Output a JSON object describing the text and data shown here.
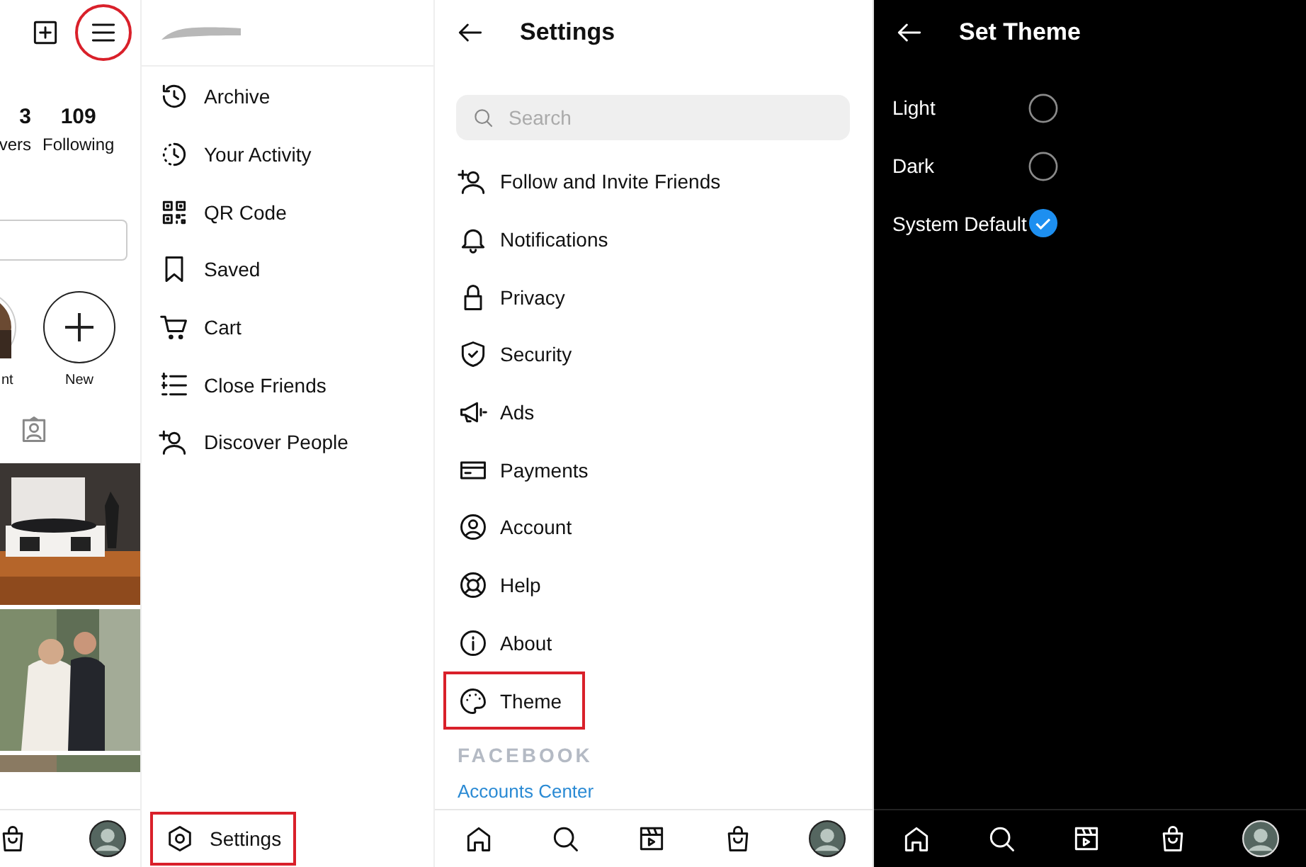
{
  "profile_panel": {
    "menu_highlighted": true,
    "stats": [
      {
        "count": "3",
        "label": "vers"
      },
      {
        "count": "109",
        "label": "Following"
      }
    ],
    "highlights": [
      {
        "kind": "picture",
        "label": "nt"
      },
      {
        "kind": "add",
        "label": "New"
      }
    ]
  },
  "drawer": {
    "items": [
      {
        "label": "Archive"
      },
      {
        "label": "Your Activity"
      },
      {
        "label": "QR Code"
      },
      {
        "label": "Saved"
      },
      {
        "label": "Cart"
      },
      {
        "label": "Close Friends"
      },
      {
        "label": "Discover People"
      }
    ],
    "settings": {
      "label": "Settings",
      "highlighted": true
    }
  },
  "settings": {
    "title": "Settings",
    "search": {
      "placeholder": "Search"
    },
    "items": [
      {
        "label": "Follow and Invite Friends",
        "highlighted": false
      },
      {
        "label": "Notifications",
        "highlighted": false
      },
      {
        "label": "Privacy",
        "highlighted": false
      },
      {
        "label": "Security",
        "highlighted": false
      },
      {
        "label": "Ads",
        "highlighted": false
      },
      {
        "label": "Payments",
        "highlighted": false
      },
      {
        "label": "Account",
        "highlighted": false
      },
      {
        "label": "Help",
        "highlighted": false
      },
      {
        "label": "About",
        "highlighted": false
      },
      {
        "label": "Theme",
        "highlighted": true
      }
    ],
    "section_heading": "FACEBOOK",
    "link": "Accounts Center"
  },
  "theme": {
    "title": "Set Theme",
    "options": [
      {
        "label": "Light",
        "selected": false
      },
      {
        "label": "Dark",
        "selected": false
      },
      {
        "label": "System Default",
        "selected": true
      }
    ]
  }
}
